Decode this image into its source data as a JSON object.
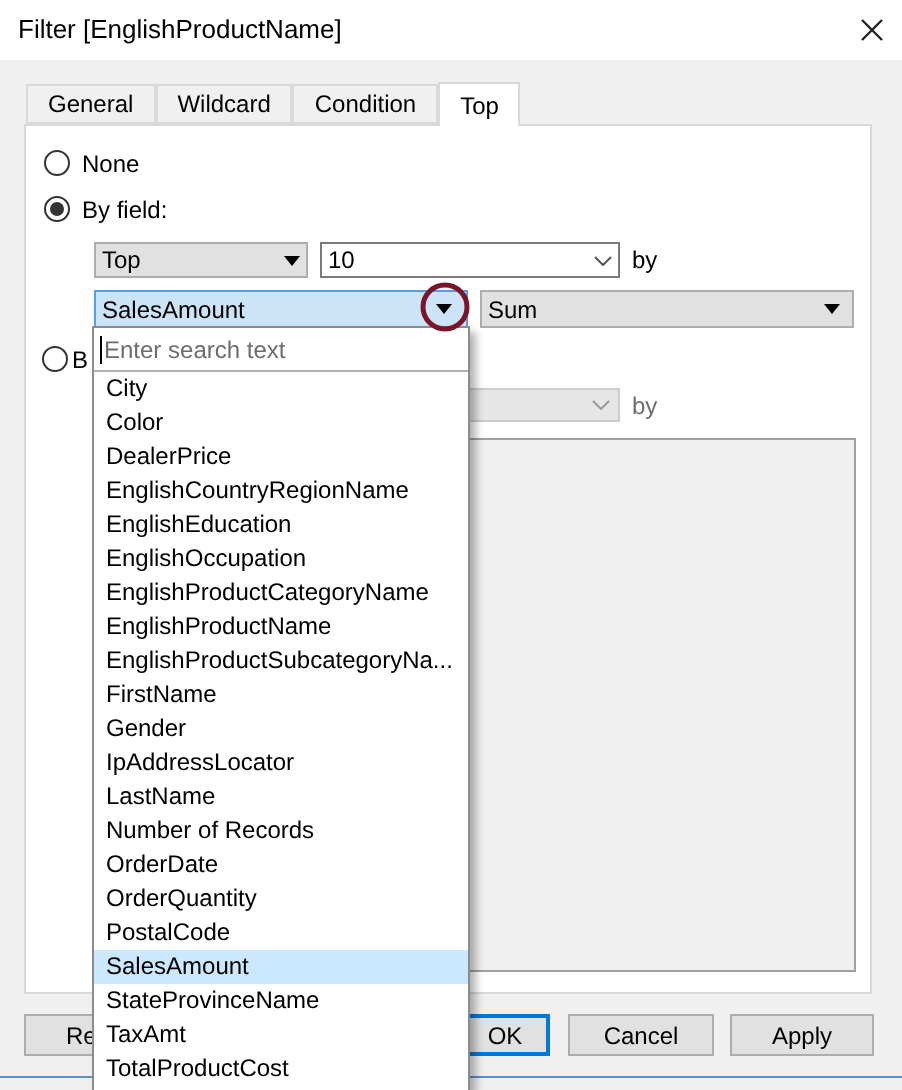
{
  "window": {
    "title": "Filter [EnglishProductName]"
  },
  "tabs": [
    {
      "label": "General",
      "selected": false
    },
    {
      "label": "Wildcard",
      "selected": false
    },
    {
      "label": "Condition",
      "selected": false
    },
    {
      "label": "Top",
      "selected": true
    }
  ],
  "options": [
    {
      "label": "None",
      "selected": false
    },
    {
      "label": "By field:",
      "selected": true
    },
    {
      "label": "B",
      "selected": false
    }
  ],
  "by_field": {
    "direction": "Top",
    "count": "10",
    "by_label": "by",
    "field": "SalesAmount",
    "aggregate": "Sum"
  },
  "by_formula": {
    "combo_disabled": true,
    "by_label": "by"
  },
  "field_dropdown": {
    "search_placeholder": "Enter search text",
    "items": [
      {
        "label": "City",
        "selected": false
      },
      {
        "label": "Color",
        "selected": false
      },
      {
        "label": "DealerPrice",
        "selected": false
      },
      {
        "label": "EnglishCountryRegionName",
        "selected": false
      },
      {
        "label": "EnglishEducation",
        "selected": false
      },
      {
        "label": "EnglishOccupation",
        "selected": false
      },
      {
        "label": "EnglishProductCategoryName",
        "selected": false
      },
      {
        "label": "EnglishProductName",
        "selected": false
      },
      {
        "label": "EnglishProductSubcategoryNa...",
        "selected": false
      },
      {
        "label": "FirstName",
        "selected": false
      },
      {
        "label": "Gender",
        "selected": false
      },
      {
        "label": "IpAddressLocator",
        "selected": false
      },
      {
        "label": "LastName",
        "selected": false
      },
      {
        "label": "Number of Records",
        "selected": false
      },
      {
        "label": "OrderDate",
        "selected": false
      },
      {
        "label": "OrderQuantity",
        "selected": false
      },
      {
        "label": "PostalCode",
        "selected": false
      },
      {
        "label": "SalesAmount",
        "selected": true
      },
      {
        "label": "StateProvinceName",
        "selected": false
      },
      {
        "label": "TaxAmt",
        "selected": false
      },
      {
        "label": "TotalProductCost",
        "selected": false
      }
    ]
  },
  "buttons": [
    {
      "label": "Re",
      "default": false
    },
    {
      "label": "OK",
      "default": true
    },
    {
      "label": "Cancel",
      "default": false
    },
    {
      "label": "Apply",
      "default": false
    }
  ]
}
